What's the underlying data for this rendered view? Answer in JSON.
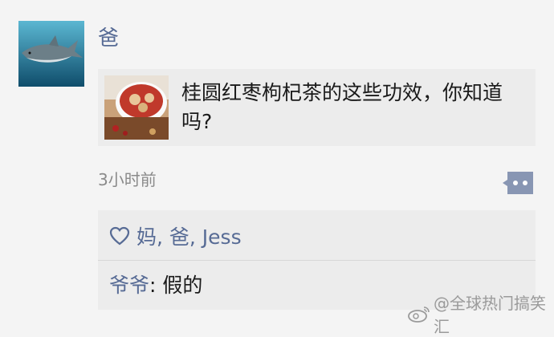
{
  "post": {
    "author": "爸",
    "link_title": "桂圆红枣枸杞茶的这些功效，你知道吗?",
    "time": "3小时前"
  },
  "feedback": {
    "likes": "妈, 爸, Jess",
    "comment_author": "爷爷",
    "comment_sep": ": ",
    "comment_text": "假的"
  },
  "watermark": {
    "text": "@全球热门搞笑汇"
  },
  "colors": {
    "name_blue": "#576b95",
    "card_bg": "#ececec",
    "page_bg": "#f4f4f4"
  }
}
